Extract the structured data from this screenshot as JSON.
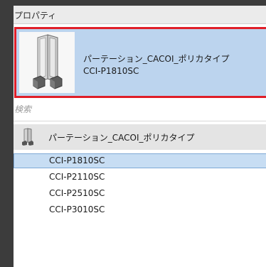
{
  "panel": {
    "title": "プロパティ"
  },
  "type_selector": {
    "family_name": "パーテーション_CACOI_ポリカタイプ",
    "type_name": "CCI-P1810SC",
    "thumbnail_icon": "partition-thumbnail-icon",
    "highlight_color": "#e01e28",
    "background_color": "#bcd4ee"
  },
  "search": {
    "placeholder": "検索"
  },
  "family_group": {
    "label": "パーテーション_CACOI_ポリカタイプ",
    "icon": "partition-family-icon"
  },
  "types": [
    {
      "label": "CCI-P1810SC",
      "selected": true
    },
    {
      "label": "CCI-P2110SC",
      "selected": false
    },
    {
      "label": "CCI-P2510SC",
      "selected": false
    },
    {
      "label": "CCI-P3010SC",
      "selected": false
    }
  ],
  "colors": {
    "selected_row": "#c7ddf3",
    "selected_border": "#7ea9d6",
    "window_background": "#3c3c3c"
  }
}
